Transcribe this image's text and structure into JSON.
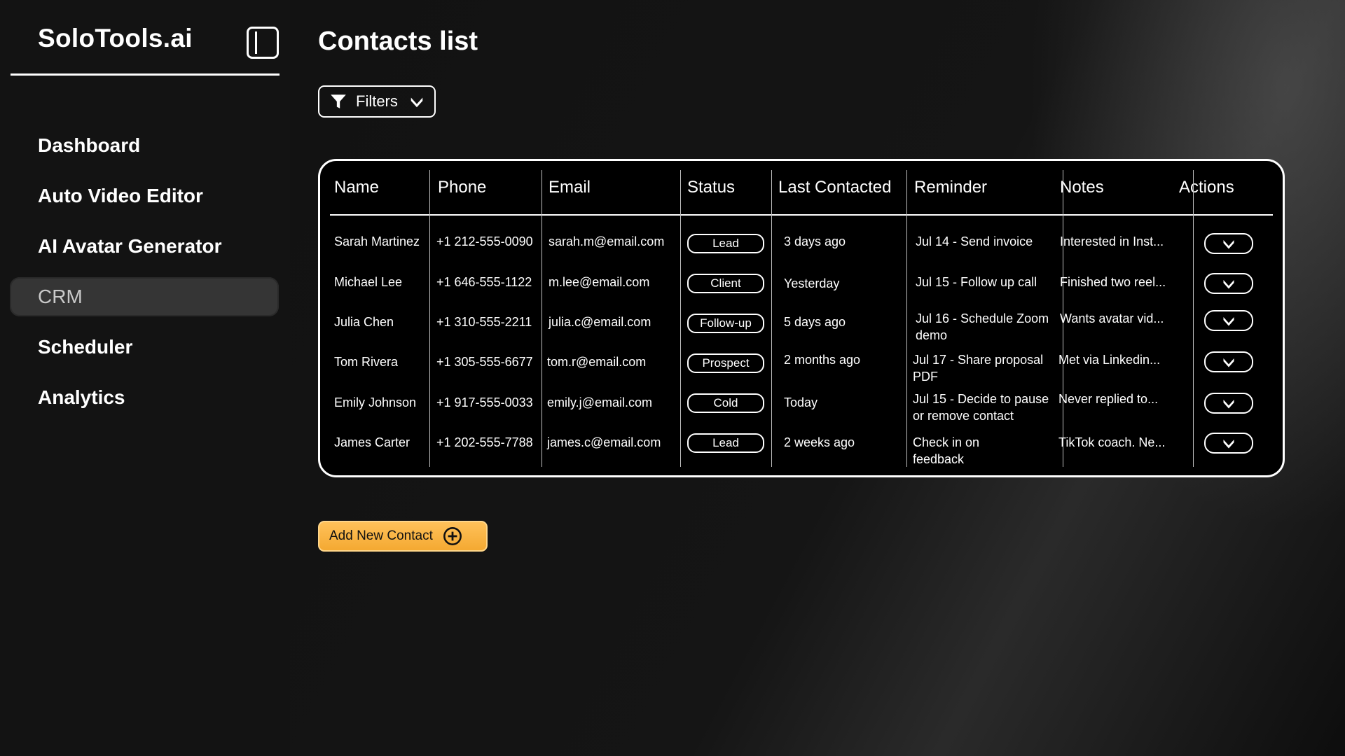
{
  "app": {
    "brand": "SoloTools.ai"
  },
  "sidebar": {
    "items": [
      {
        "label": "Dashboard"
      },
      {
        "label": "Auto Video Editor"
      },
      {
        "label": "AI Avatar Generator"
      },
      {
        "label": "CRM",
        "active": true
      },
      {
        "label": "Scheduler"
      },
      {
        "label": "Analytics"
      }
    ]
  },
  "main": {
    "title": "Contacts list",
    "filters_label": "Filters",
    "add_contact_label": "Add New Contact"
  },
  "table": {
    "headers": [
      "Name",
      "Phone",
      "Email",
      "Status",
      "Last Contacted",
      "Reminder",
      "Notes",
      "Actions"
    ],
    "rows": [
      {
        "name": "Sarah Martinez",
        "phone": "+1 212-555-0090",
        "email": "sarah.m@email.com",
        "status": "Lead",
        "last": "3 days ago",
        "reminder": "Jul 14 - Send invoice",
        "notes": "Interested in Inst..."
      },
      {
        "name": "Michael Lee",
        "phone": "+1 646-555-1122",
        "email": "m.lee@email.com",
        "status": "Client",
        "last": "Yesterday",
        "reminder": "Jul 15 - Follow up call",
        "notes": "Finished two reel..."
      },
      {
        "name": "Julia Chen",
        "phone": "+1 310-555-2211",
        "email": "julia.c@email.com",
        "status": "Follow-up",
        "last": "5 days ago",
        "reminder": "Jul 16 - Schedule Zoom demo",
        "notes": "Wants avatar vid..."
      },
      {
        "name": "Tom Rivera",
        "phone": "+1 305-555-6677",
        "email": "tom.r@email.com",
        "status": "Prospect",
        "last": "2 months ago",
        "reminder": "Jul 17 - Share proposal PDF",
        "notes": "Met via Linkedin..."
      },
      {
        "name": "Emily Johnson",
        "phone": "+1 917-555-0033",
        "email": "emily.j@email.com",
        "status": "Cold",
        "last": "Today",
        "reminder": "Jul 15 - Decide to pause or remove contact",
        "notes": "Never replied to..."
      },
      {
        "name": "James Carter",
        "phone": "+1 202-555-7788",
        "email": "james.c@email.com",
        "status": "Lead",
        "last": "2 weeks ago",
        "reminder": "Check in on feedback",
        "notes": "TikTok coach. Ne..."
      }
    ]
  },
  "icons": {
    "collapse": "sidebar-toggle-icon",
    "filter": "funnel-icon",
    "dropdown": "chevron-down-icon",
    "add": "plus-circle-icon"
  },
  "colors": {
    "accent": "#f4a932",
    "background": "#0c0c0c",
    "sidebar": "#131313",
    "active_nav": "#353535"
  }
}
